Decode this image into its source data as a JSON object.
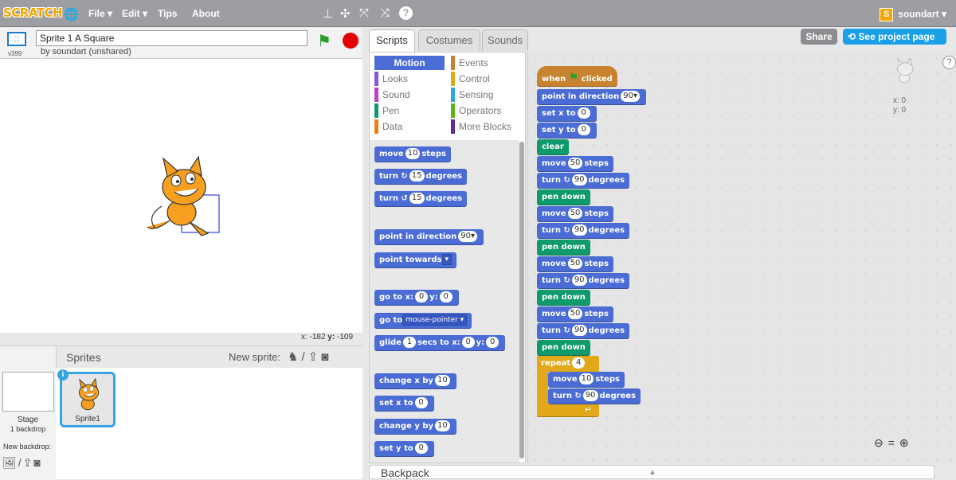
{
  "topbar": {
    "logo": "SCRATCH",
    "menus": [
      "File ▾",
      "Edit ▾",
      "Tips",
      "About"
    ],
    "user": "soundart ▾",
    "user_icon": "S"
  },
  "stage": {
    "version": "v399",
    "title": "Sprite 1 A Square",
    "byline": "by soundart (unshared)",
    "mouse_x_label": "x:",
    "mouse_x": "-182",
    "mouse_y_label": "y:",
    "mouse_y": "-109"
  },
  "sprites": {
    "header": "Sprites",
    "new_sprite": "New sprite:",
    "stage_label": "Stage",
    "backdrop_count": "1 backdrop",
    "new_backdrop": "New backdrop:",
    "sprite_name": "Sprite1"
  },
  "tabs": [
    "Scripts",
    "Costumes",
    "Sounds"
  ],
  "actions": {
    "share": "Share",
    "see_project": "See project page"
  },
  "categories": [
    {
      "label": "Motion",
      "color": "#4a6cd4",
      "active": true
    },
    {
      "label": "Events",
      "color": "#c88330"
    },
    {
      "label": "Looks",
      "color": "#8a55d7"
    },
    {
      "label": "Control",
      "color": "#e1a91a"
    },
    {
      "label": "Sound",
      "color": "#bb42c3"
    },
    {
      "label": "Sensing",
      "color": "#2ca5e2"
    },
    {
      "label": "Pen",
      "color": "#0e9a6c"
    },
    {
      "label": "Operators",
      "color": "#5cb712"
    },
    {
      "label": "Data",
      "color": "#ee7d16"
    },
    {
      "label": "More Blocks",
      "color": "#632d99"
    }
  ],
  "palette_blocks": {
    "move": {
      "pre": "move",
      "num": "10",
      "post": "steps"
    },
    "turn_right": {
      "pre": "turn ↻",
      "num": "15",
      "post": "degrees"
    },
    "turn_left": {
      "pre": "turn ↺",
      "num": "15",
      "post": "degrees"
    },
    "point_dir": {
      "pre": "point in direction",
      "num": "90▾"
    },
    "point_towards": {
      "pre": "point towards",
      "drop": "▾"
    },
    "goto_xy": {
      "pre": "go to x:",
      "x": "0",
      "mid": "y:",
      "y": "0"
    },
    "goto": {
      "pre": "go to",
      "drop": "mouse-pointer ▾"
    },
    "glide": {
      "pre": "glide",
      "num": "1",
      "mid": "secs to x:",
      "x": "0",
      "mid2": "y:",
      "y": "0"
    },
    "change_x": {
      "pre": "change x by",
      "num": "10"
    },
    "set_x": {
      "pre": "set x to",
      "num": "0"
    },
    "change_y": {
      "pre": "change y by",
      "num": "10"
    },
    "set_y": {
      "pre": "set y to",
      "num": "0"
    }
  },
  "script": {
    "when_clicked": {
      "pre": "when",
      "post": "clicked"
    },
    "point_dir": {
      "pre": "point in direction",
      "num": "90▾"
    },
    "set_x": {
      "pre": "set x to",
      "num": "0"
    },
    "set_y": {
      "pre": "set y to",
      "num": "0"
    },
    "clear": "clear",
    "move_label": "move",
    "steps_label": "steps",
    "turn_label": "turn ↻",
    "degrees_label": "degrees",
    "pen_down": "pen down",
    "move_steps": "50",
    "turn_deg": "90",
    "repeat": {
      "pre": "repeat",
      "num": "4"
    },
    "inner_move": "10",
    "inner_turn": "90",
    "repeat_end": "↵"
  },
  "sprite_info": {
    "x": "x: 0",
    "y": "y: 0"
  },
  "backpack": "Backpack"
}
